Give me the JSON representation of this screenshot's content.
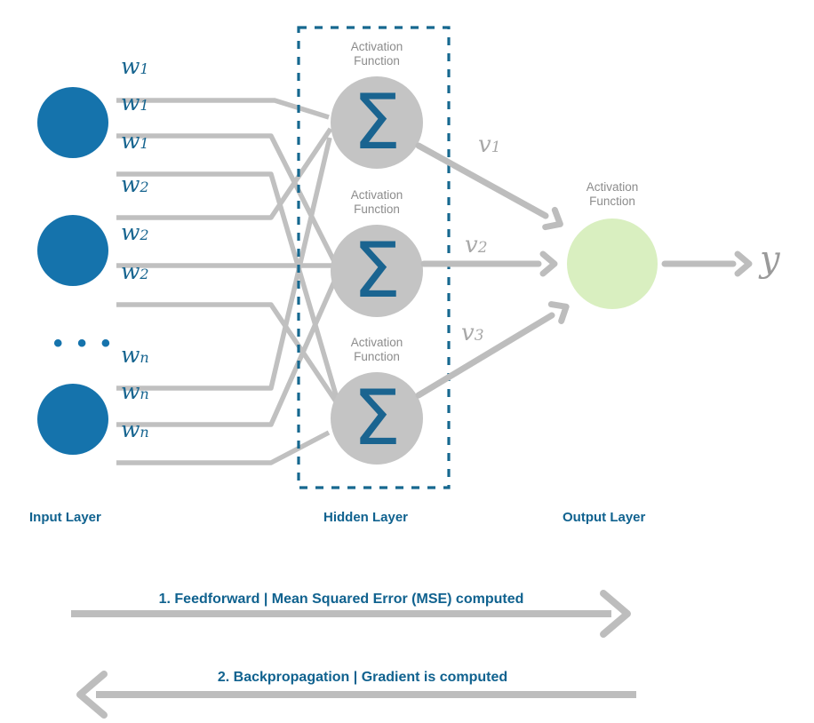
{
  "diagram": {
    "title": "Neural Network Feedforward and Backpropagation Diagram",
    "colors": {
      "input_node": "#1573ac",
      "hidden_node": "#c4c4c4",
      "output_node": "#d9efc0",
      "sigma": "#1a6490",
      "dashed_box": "#16688f",
      "connection": "#c0c0c0",
      "arrow": "#bdbdbd",
      "label_blue": "#10628f",
      "label_gray": "#8c8c8c",
      "math_gray": "#a0a0a0"
    }
  },
  "layers": {
    "input": {
      "label": "Input Layer",
      "ellipsis": "• • •",
      "nodes": [
        {
          "name": "input-node-1"
        },
        {
          "name": "input-node-2"
        },
        {
          "name": "input-node-n"
        }
      ]
    },
    "hidden": {
      "label": "Hidden Layer",
      "activation_label": "Activation\nFunction",
      "sigma_symbol": "Σ",
      "nodes": [
        {
          "name": "hidden-node-1"
        },
        {
          "name": "hidden-node-2"
        },
        {
          "name": "hidden-node-3"
        }
      ]
    },
    "output": {
      "label": "Output Layer",
      "activation_label": "Activation\nFunction",
      "output_symbol": "y",
      "nodes": [
        {
          "name": "output-node-1"
        }
      ]
    }
  },
  "weights": [
    {
      "base": "w",
      "sub": "1"
    },
    {
      "base": "w",
      "sub": "1"
    },
    {
      "base": "w",
      "sub": "1"
    },
    {
      "base": "w",
      "sub": "2"
    },
    {
      "base": "w",
      "sub": "2"
    },
    {
      "base": "w",
      "sub": "2"
    },
    {
      "base": "w",
      "sub": "n"
    },
    {
      "base": "w",
      "sub": "n"
    },
    {
      "base": "w",
      "sub": "n"
    }
  ],
  "hidden_to_output_weights": [
    {
      "base": "v",
      "sub": "1"
    },
    {
      "base": "v",
      "sub": "2"
    },
    {
      "base": "v",
      "sub": "3"
    }
  ],
  "flow_steps": [
    {
      "text": "1. Feedforward | Mean Squared Error (MSE) computed",
      "direction": "right"
    },
    {
      "text": "2. Backpropagation | Gradient is computed",
      "direction": "left"
    }
  ]
}
